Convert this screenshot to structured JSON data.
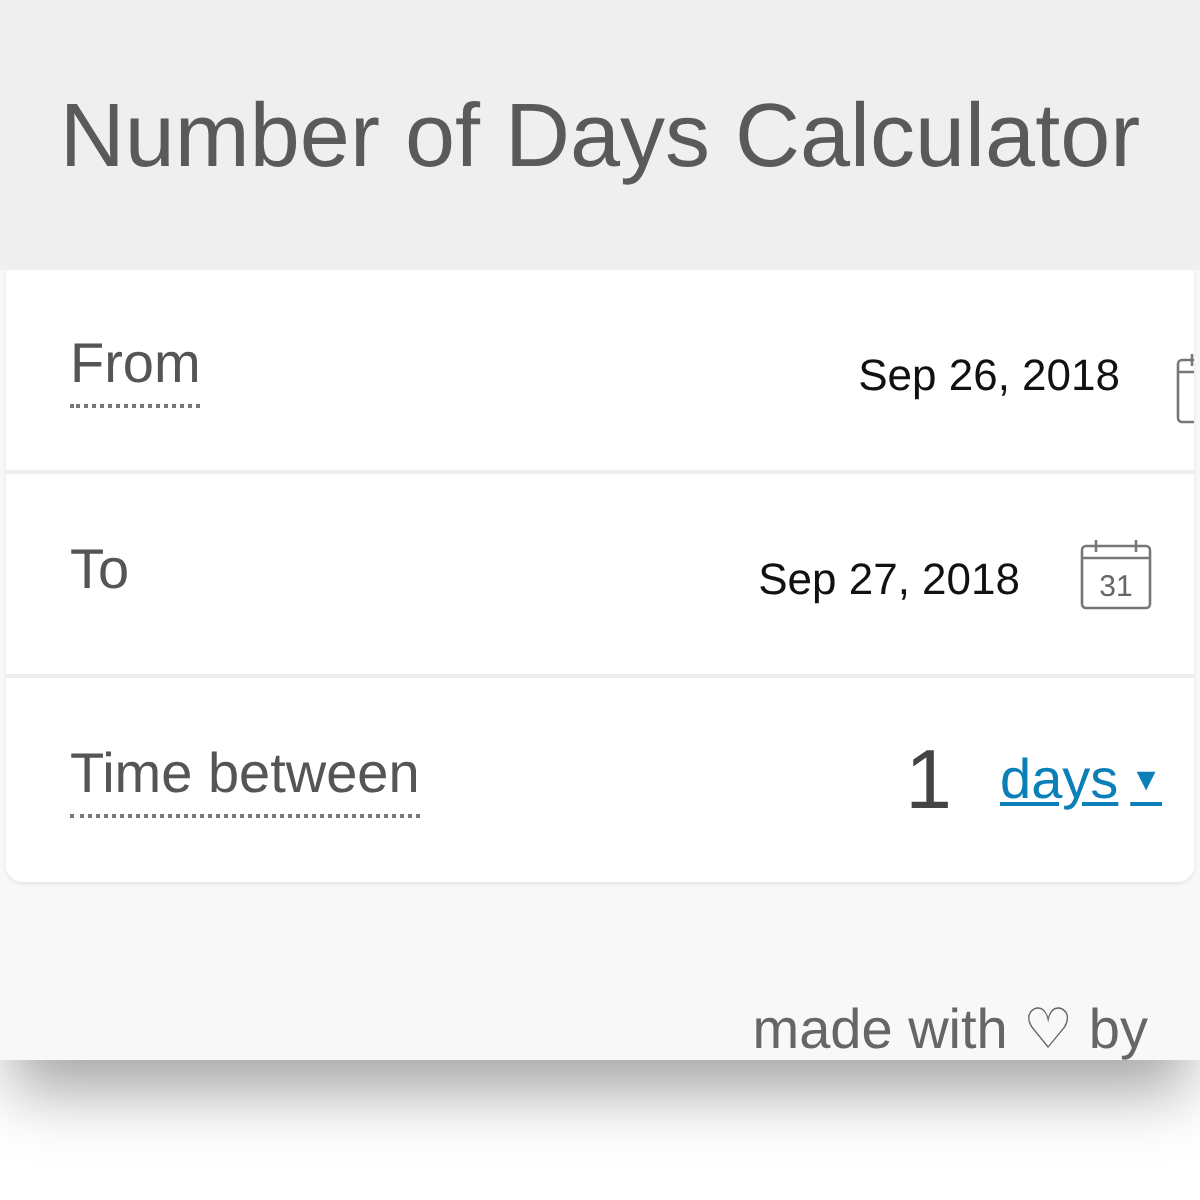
{
  "title": "Number of Days Calculator",
  "rows": [
    {
      "kind": "date",
      "label": "From",
      "dotted": true,
      "value": "Sep 26, 2018",
      "icon_text": ""
    },
    {
      "kind": "date",
      "label": "To",
      "dotted": false,
      "value": "Sep 27, 2018",
      "icon_text": "31"
    },
    {
      "kind": "result",
      "label": "Time between",
      "dotted": true,
      "value": "1",
      "unit": "days",
      "caret": "▼"
    }
  ],
  "footer": "made with ♡ by"
}
